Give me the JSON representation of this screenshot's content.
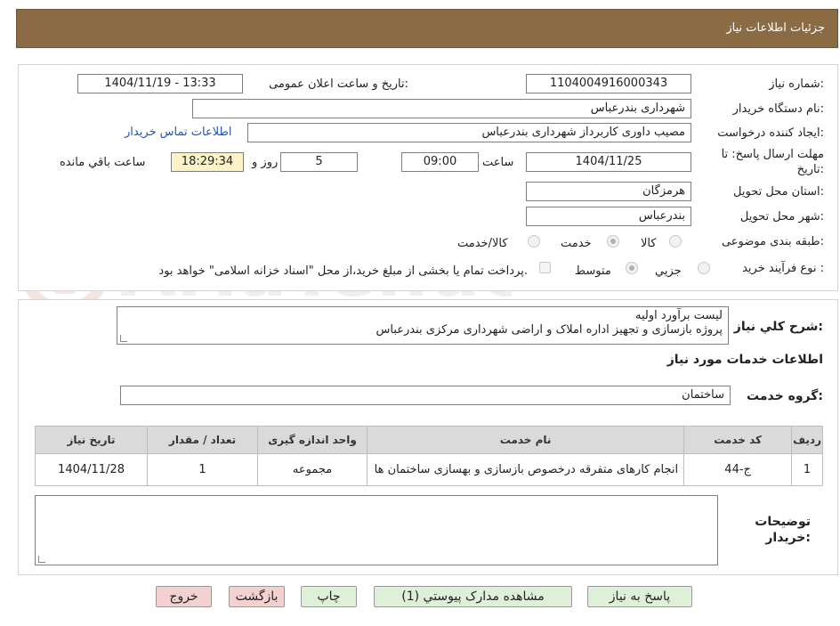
{
  "header": {
    "title": "جزئیات اطلاعات نیاز"
  },
  "form": {
    "need_number": {
      "label": "شماره نیاز:",
      "value": "1104004916000343"
    },
    "announce": {
      "label": "تاریخ و ساعت اعلان عمومی:",
      "value": "1404/11/19 - 13:33"
    },
    "buyer_org": {
      "label": "نام دستگاه خریدار:",
      "value": "شهرداری بندرعباس"
    },
    "creator": {
      "label": "ایجاد کننده درخواست:",
      "value": "مصیب داوری کاربرداز شهرداری بندرعباس",
      "contact_link": "اطلاعات تماس خریدار"
    },
    "deadline": {
      "label": "مهلت ارسال پاسخ: تا تاریخ:",
      "date": "1404/11/25",
      "time_label": "ساعت",
      "time": "09:00",
      "days": "5",
      "days_label": "روز و",
      "remaining": "18:29:34",
      "remaining_label": "ساعت باقي مانده"
    },
    "province": {
      "label": "استان محل تحویل:",
      "value": "هرمزگان"
    },
    "city": {
      "label": "شهر محل تحویل:",
      "value": "بندرعباس"
    },
    "category": {
      "label": "طبقه بندی موضوعی:",
      "options": [
        "کالا",
        "خدمت",
        "کالا/خدمت"
      ],
      "selected": "خدمت"
    },
    "purchase_type": {
      "label": "نوع فرآیند خرید :",
      "options": [
        "جزیي",
        "متوسط"
      ],
      "selected": "متوسط",
      "note": "پرداخت تمام یا بخشی از مبلغ خرید،از محل \"اسناد خزانه اسلامی\" خواهد بود."
    }
  },
  "description": {
    "label": "شرح کلي نياز:",
    "line1": "لیست برآورد اولیه",
    "line2": "پروژه بازسازی و تجهیز اداره املاک و اراضی شهرداری مرکزی بندرعباس"
  },
  "services": {
    "title": "اطلاعات خدمات مورد نیاز",
    "group_label": "گروه خدمت:",
    "group_value": "ساختمان",
    "columns": [
      "ردیف",
      "کد خدمت",
      "نام خدمت",
      "واحد اندازه گیری",
      "تعداد / مقدار",
      "تاریخ نیاز"
    ],
    "rows": [
      {
        "row": "1",
        "code": "ج-44",
        "name": "انجام کارهای متفرقه درخصوص بازسازی و بهسازی ساختمان ها",
        "unit": "مجموعه",
        "qty": "1",
        "date": "1404/11/28"
      }
    ]
  },
  "buyer_notes": {
    "label": "توضیحات خریدار:",
    "value": ""
  },
  "buttons": {
    "reply": "پاسخ به نیاز",
    "attachments": "مشاهده مدارک پیوستي (1)",
    "print": "چاپ",
    "back": "بازگشت",
    "exit": "خروج"
  },
  "watermark": {
    "text": "AriaTender.neT"
  },
  "colors": {
    "header_bg": "#8a6b44",
    "link": "#1f55b6",
    "green_btn": "#dff0d8",
    "pink_btn": "#f3d1d1",
    "timer_bg": "#fbf3c7"
  }
}
